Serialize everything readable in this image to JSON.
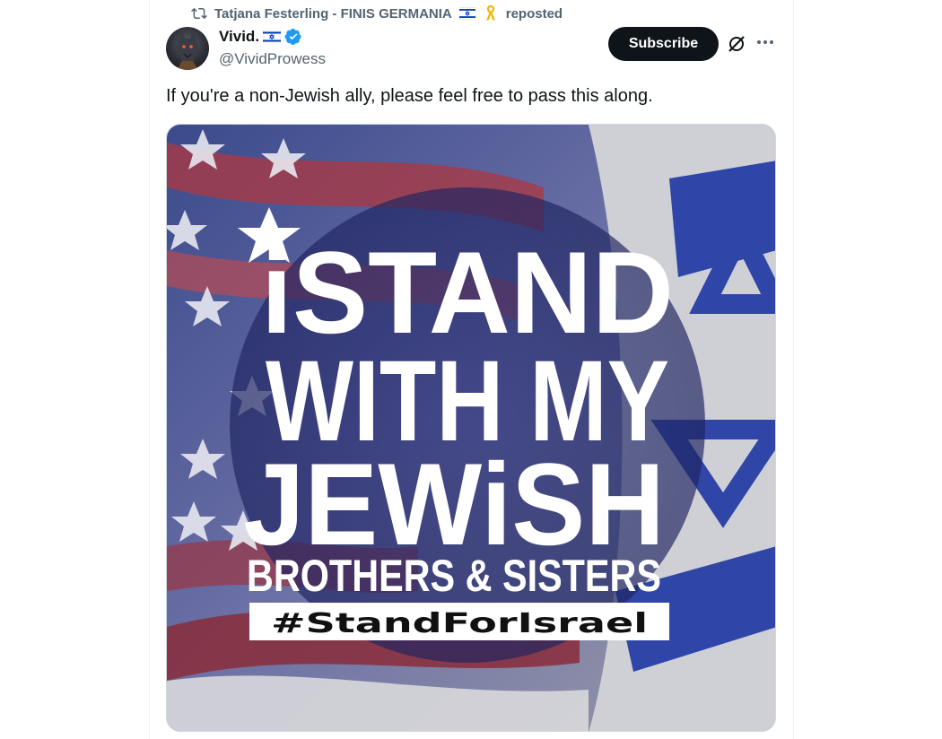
{
  "repost": {
    "user": "Tatjana Festerling - FINIS GERMANIA",
    "label": "reposted"
  },
  "author": {
    "name": "Vivid.",
    "handle": "@VividProwess"
  },
  "header": {
    "subscribe_label": "Subscribe"
  },
  "tweet": {
    "text": "If you're a non-Jewish ally, please feel free to pass this along."
  },
  "media": {
    "line1": "iSTAND",
    "line2": "WITH MY",
    "line3": "JEWiSH",
    "line4": "BROTHERS & SISTERS",
    "hashtag": "#StandForIsrael"
  },
  "colors": {
    "text_primary": "#0f1419",
    "text_secondary": "#536471",
    "verified_blue": "#1d9bf0",
    "israel_blue": "#0038b8"
  }
}
